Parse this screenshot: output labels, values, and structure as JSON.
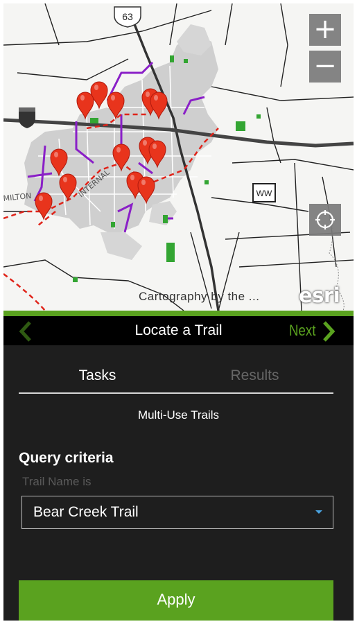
{
  "map": {
    "highway_shield": "63",
    "route_marker": "WW",
    "attribution": "Cartography by the ...",
    "logo": "esri",
    "street_labels": [
      "MILTON",
      "INTERNAL"
    ],
    "colors": {
      "city_area": "#cfcfcf",
      "trail_purple": "#8a1fc7",
      "trail_red": "#e0241a",
      "park_green": "#33a532",
      "pin_red": "#e8341c"
    }
  },
  "controls": {
    "zoom_in": "+",
    "zoom_out": "−",
    "locate_icon": "locate-icon"
  },
  "header": {
    "title": "Locate a Trail",
    "next_label": "Next"
  },
  "tabs": [
    {
      "label": "Tasks",
      "active": true
    },
    {
      "label": "Results",
      "active": false
    }
  ],
  "subtitle": "Multi-Use Trails",
  "query": {
    "heading": "Query criteria",
    "field_label": "Trail Name is",
    "selected": "Bear Creek Trail"
  },
  "apply_label": "Apply",
  "accent_color": "#5aa21f"
}
